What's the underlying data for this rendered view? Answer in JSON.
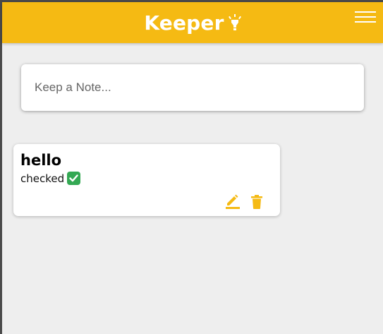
{
  "header": {
    "title": "Keeper",
    "logo_icon": "lightbulb-icon",
    "menu_icon": "hamburger-menu-icon",
    "accent_color": "#f5ba13"
  },
  "create_note": {
    "placeholder": "Keep a Note..."
  },
  "notes": [
    {
      "title": "hello",
      "content": "checked",
      "content_emoji": "check-mark-button-icon",
      "actions": [
        "edit-icon",
        "delete-icon"
      ]
    }
  ]
}
